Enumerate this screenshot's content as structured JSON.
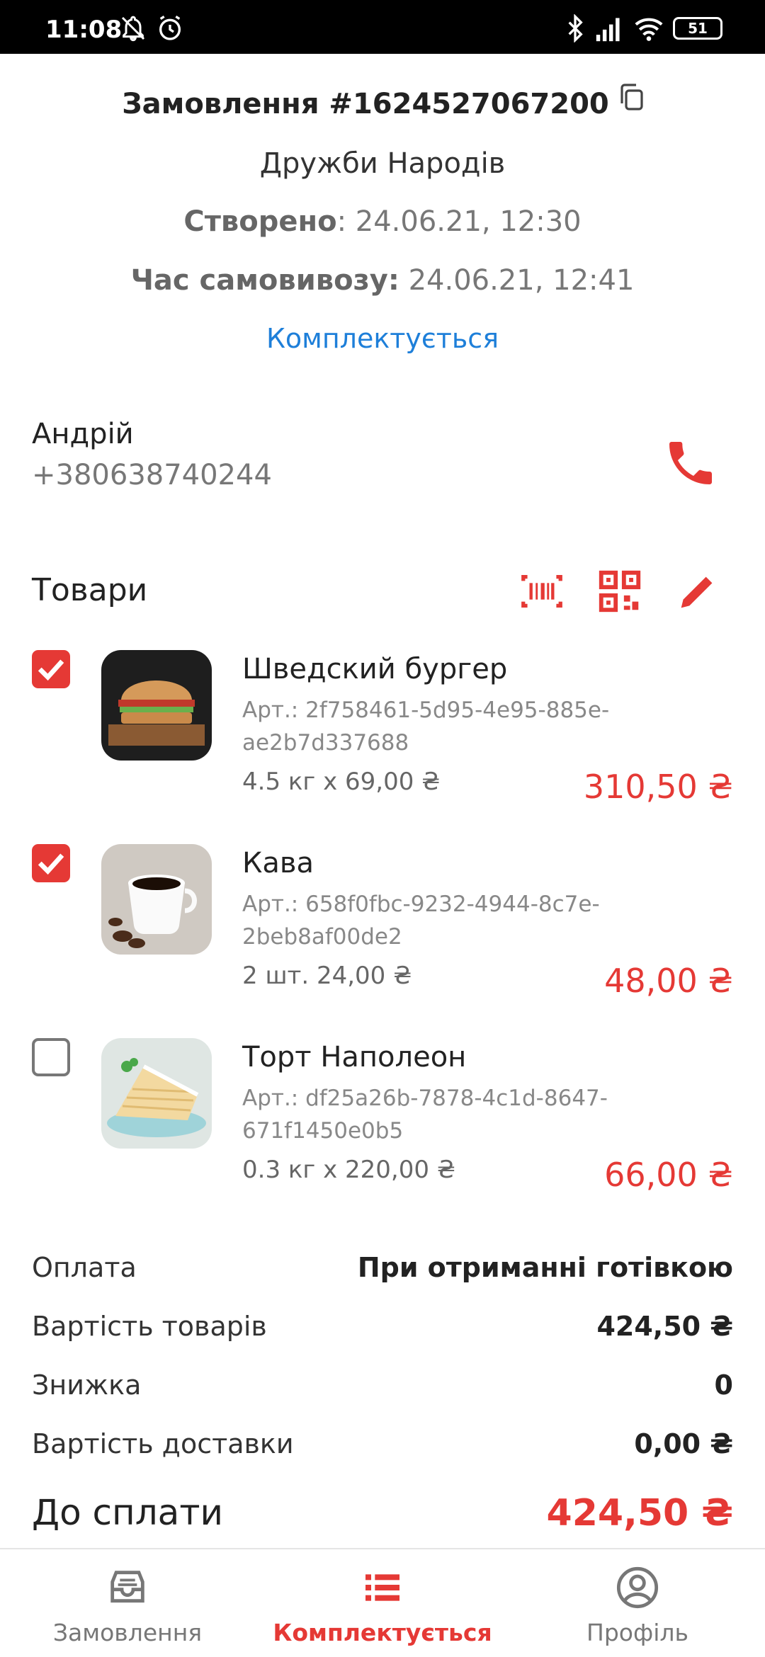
{
  "status_bar": {
    "time": "11:08",
    "battery": "51"
  },
  "order": {
    "title": "Замовлення #1624527067200",
    "store": "Дружби Народів",
    "created_label": "Створено",
    "created_value": ": 24.06.21, 12:30",
    "pickup_label": "Час самовивозу:",
    "pickup_value": " 24.06.21, 12:41",
    "status": "Комплектується"
  },
  "customer": {
    "name": "Андрій",
    "phone": "+380638740244"
  },
  "goods": {
    "title": "Товари",
    "items": [
      {
        "name": "Шведский бургер",
        "sku_1": "Арт.: 2f758461-5d95-4e95-885e-",
        "sku_2": "ae2b7d337688",
        "qty": "4.5 кг х 69,00 ₴",
        "total": "310,50 ₴",
        "checked": true
      },
      {
        "name": "Кава",
        "sku_1": "Арт.: 658f0fbc-9232-4944-8c7e-",
        "sku_2": "2beb8af00de2",
        "qty": "2 шт. 24,00 ₴",
        "total": "48,00 ₴",
        "checked": true
      },
      {
        "name": "Торт Наполеон",
        "sku_1": "Арт.: df25a26b-7878-4c1d-8647-",
        "sku_2": "671f1450e0b5",
        "qty": "0.3 кг х 220,00 ₴",
        "total": "66,00 ₴",
        "checked": false
      }
    ]
  },
  "summary": {
    "payment_label": "Оплата",
    "payment_value": "При отриманні готівкою",
    "goods_cost_label": "Вартість товарів",
    "goods_cost_value": "424,50 ₴",
    "discount_label": "Знижка",
    "discount_value": "0",
    "delivery_label": "Вартість доставки",
    "delivery_value": "0,00 ₴",
    "to_pay_label": "До сплати",
    "to_pay_value": "424,50 ₴"
  },
  "nav": {
    "orders": "Замовлення",
    "picking": "Комплектується",
    "profile": "Профіль"
  },
  "colors": {
    "accent": "#e53935",
    "link": "#1e7fd9"
  }
}
